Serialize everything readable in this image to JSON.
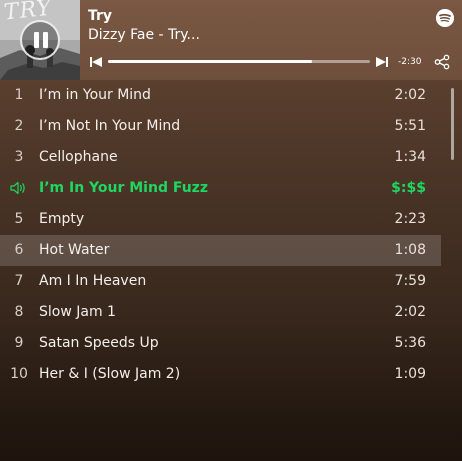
{
  "cover": {
    "art_text": "TRY",
    "art_colors": {
      "sky": "#b0b0b0",
      "ground": "#5a5a5a"
    }
  },
  "now_playing": {
    "title": "Try",
    "artist": "Dizzy Fae - Try...",
    "remaining": "-2:30",
    "progress_fraction": 0.78,
    "icons": {
      "play_state": "pause-icon",
      "brand": "spotify-icon",
      "prev": "skip-previous-icon",
      "next": "skip-next-icon",
      "share": "share-icon"
    }
  },
  "tracks": [
    {
      "num": "1",
      "name": "I’m in Your Mind",
      "duration": "2:02"
    },
    {
      "num": "2",
      "name": "I’m Not In Your Mind",
      "duration": "5:51"
    },
    {
      "num": "3",
      "name": "Cellophane",
      "duration": "1:34"
    },
    {
      "num": "",
      "name": "I’m In Your Mind Fuzz",
      "duration": "$:$$",
      "playing": true,
      "icon": "speaker-icon"
    },
    {
      "num": "5",
      "name": "Empty",
      "duration": "2:23"
    },
    {
      "num": "6",
      "name": "Hot Water",
      "duration": "1:08",
      "selected": true
    },
    {
      "num": "7",
      "name": "Am I In Heaven",
      "duration": "7:59"
    },
    {
      "num": "8",
      "name": "Slow Jam 1",
      "duration": "2:02"
    },
    {
      "num": "9",
      "name": "Satan Speeds Up",
      "duration": "5:36"
    },
    {
      "num": "10",
      "name": "Her & I (Slow Jam 2)",
      "duration": "1:09"
    }
  ],
  "colors": {
    "accent": "#1ed760",
    "header_bg": "#6e4f3b",
    "selected_row_bg": "rgba(255,255,255,0.16)"
  }
}
